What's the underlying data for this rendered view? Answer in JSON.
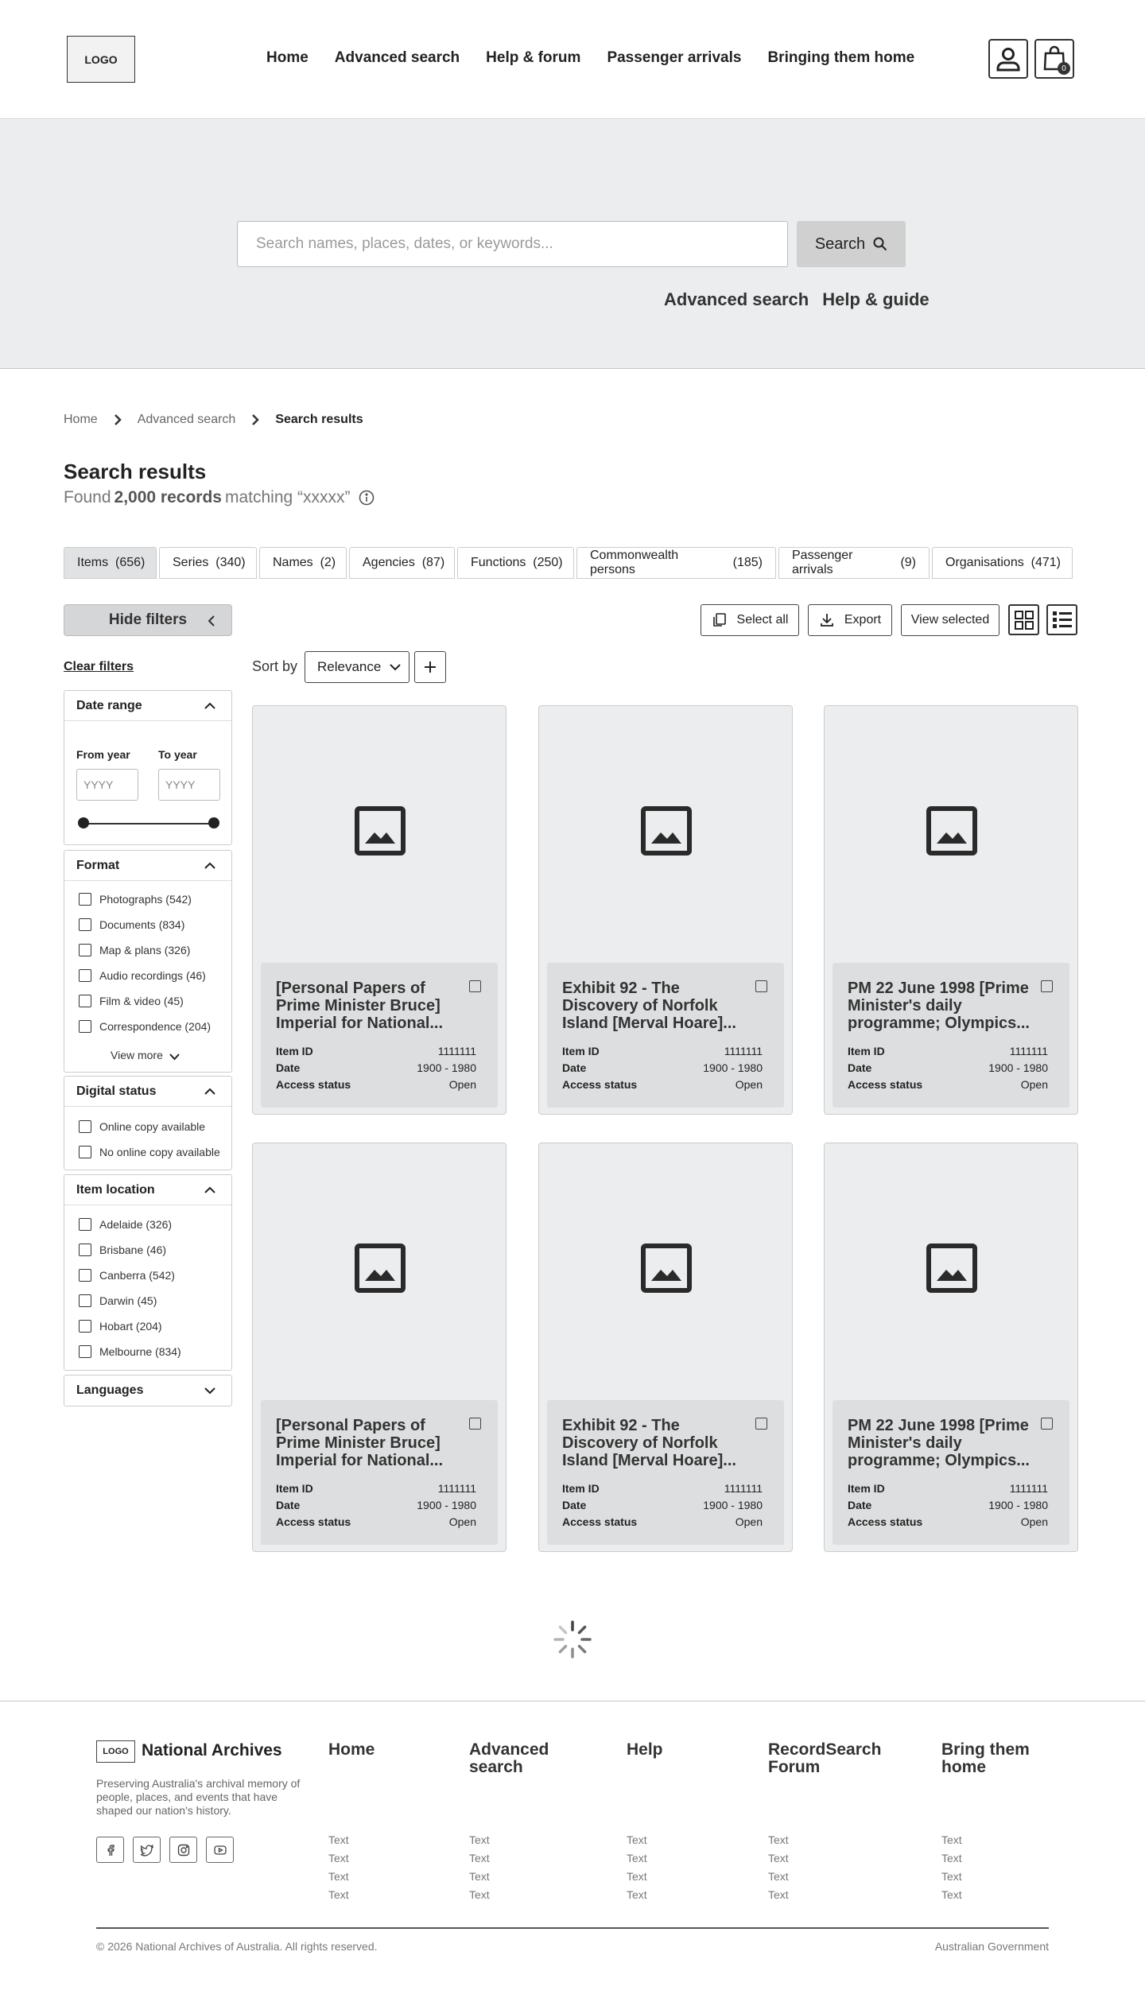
{
  "header": {
    "logo": "LOGO",
    "nav": [
      "Home",
      "Advanced search",
      "Help & forum",
      "Passenger arrivals",
      "Bringing them home"
    ],
    "cart_count": "0"
  },
  "hero": {
    "search_placeholder": "Search names, places, dates, or keywords...",
    "search_button": "Search",
    "links": [
      "Advanced search",
      "Help & guide"
    ]
  },
  "breadcrumb": [
    "Home",
    "Advanced search",
    "Search results"
  ],
  "results": {
    "title": "Search results",
    "found_prefix": "Found",
    "found_count": "2,000 records",
    "found_suffix": "matching “xxxxx”"
  },
  "tabs": [
    {
      "label": "Items",
      "count": "(656)"
    },
    {
      "label": "Series",
      "count": "(340)"
    },
    {
      "label": "Names",
      "count": "(2)"
    },
    {
      "label": "Agencies",
      "count": "(87)"
    },
    {
      "label": "Functions",
      "count": "(250)"
    },
    {
      "label": "Commonwealth persons",
      "count": "(185)"
    },
    {
      "label": "Passenger arrivals",
      "count": "(9)"
    },
    {
      "label": "Organisations",
      "count": "(471)"
    }
  ],
  "toolbar": {
    "hide_filters": "Hide filters",
    "select_all": "Select all",
    "export": "Export",
    "view_selected": "View selected",
    "clear_filters": "Clear filters",
    "sort_by": "Sort by",
    "sort_value": "Relevance"
  },
  "filters": {
    "date_range": {
      "title": "Date range",
      "from_label": "From year",
      "to_label": "To year",
      "placeholder": "YYYY"
    },
    "format": {
      "title": "Format",
      "items": [
        "Photographs (542)",
        "Documents (834)",
        "Map & plans (326)",
        "Audio recordings (46)",
        "Film & video (45)",
        "Correspondence (204)"
      ],
      "view_more": "View more"
    },
    "digital_status": {
      "title": "Digital status",
      "items": [
        "Online copy available",
        "No online copy available"
      ]
    },
    "item_location": {
      "title": "Item location",
      "items": [
        "Adelaide (326)",
        "Brisbane (46)",
        "Canberra (542)",
        "Darwin (45)",
        "Hobart (204)",
        "Melbourne (834)"
      ]
    },
    "languages": {
      "title": "Languages"
    }
  },
  "cards": [
    {
      "title": "[Personal Papers of Prime Minister Bruce] Imperial for National...",
      "item_id": "1111111",
      "date": "1900 - 1980",
      "access": "Open"
    },
    {
      "title": "Exhibit 92 - The Discovery of Norfolk Island [Merval Hoare]...",
      "item_id": "1111111",
      "date": "1900 - 1980",
      "access": "Open"
    },
    {
      "title": "PM 22 June 1998 [Prime Minister's daily programme; Olympics...",
      "item_id": "1111111",
      "date": "1900 - 1980",
      "access": "Open"
    },
    {
      "title": "[Personal Papers of Prime Minister Bruce] Imperial for National...",
      "item_id": "1111111",
      "date": "1900 - 1980",
      "access": "Open"
    },
    {
      "title": "Exhibit 92 - The Discovery of Norfolk Island [Merval Hoare]...",
      "item_id": "1111111",
      "date": "1900 - 1980",
      "access": "Open"
    },
    {
      "title": "PM 22 June 1998 [Prime Minister's daily programme; Olympics...",
      "item_id": "1111111",
      "date": "1900 - 1980",
      "access": "Open"
    }
  ],
  "card_labels": {
    "item_id": "Item ID",
    "date": "Date",
    "access": "Access status"
  },
  "footer": {
    "logo": "LOGO",
    "brand": "National Archives",
    "description": "Preserving Australia's archival memory of people, places, and events that have shaped our nation's history.",
    "columns": [
      {
        "title": "Home",
        "links": [
          "Text",
          "Text",
          "Text",
          "Text"
        ]
      },
      {
        "title": "Advanced search",
        "links": [
          "Text",
          "Text",
          "Text",
          "Text"
        ]
      },
      {
        "title": "Help",
        "links": [
          "Text",
          "Text",
          "Text",
          "Text"
        ]
      },
      {
        "title": "RecordSearch Forum",
        "links": [
          "Text",
          "Text",
          "Text",
          "Text"
        ]
      },
      {
        "title": "Bring them home",
        "links": [
          "Text",
          "Text",
          "Text",
          "Text"
        ]
      }
    ],
    "copyright": "© 2026 National Archives of Australia. All rights reserved.",
    "gov": "Australian Government"
  }
}
